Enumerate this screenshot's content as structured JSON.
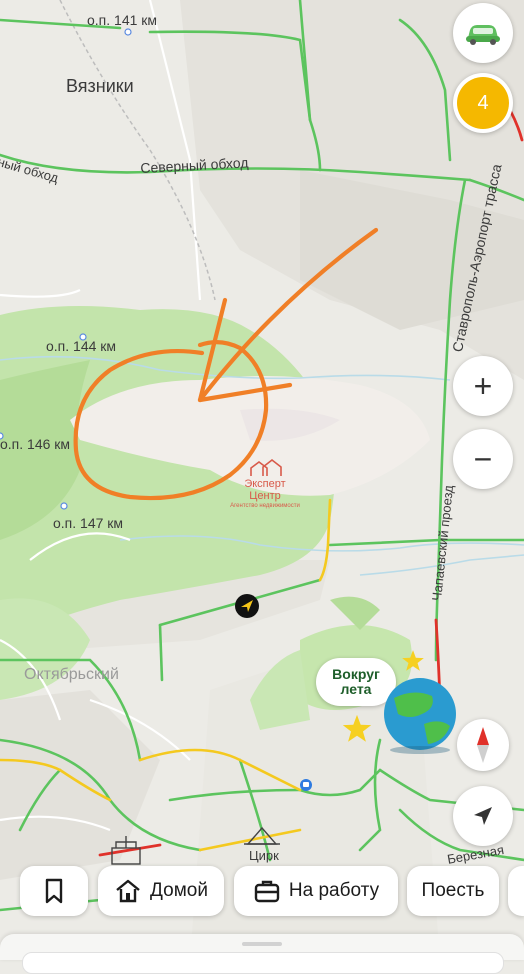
{
  "map": {
    "place_labels": {
      "vyazniki": "Вязники",
      "oktyabrsky": "Октябрьский",
      "circus": "Цирк"
    },
    "road_labels": {
      "northern_bypass_left": "ный обход",
      "northern_bypass": "Северный обход",
      "airport_road": "Ставрополь-Аэропорт трасса",
      "chapaevsky": "Чапаевский проезд",
      "beryozovaya": "Березная"
    },
    "stop_labels": {
      "op141": "о.п. 141 км",
      "op144": "о.п. 144 км",
      "op146": "о.п. 146 км",
      "op147": "о.п. 147 км"
    },
    "watermark": {
      "name": "Эксперт Центр",
      "tagline": "Агентство недвижимости"
    },
    "promo_text": "Вокруг лета",
    "annotation": "hand-drawn orange circle with arrow"
  },
  "controls": {
    "car_mode_icon": "car-icon",
    "notification_count": "4",
    "zoom_in_symbol": "+",
    "zoom_out_symbol": "−",
    "compass_icon": "compass-icon",
    "locate_icon": "navigation-arrow-icon"
  },
  "quick_actions": {
    "bookmark_icon": "bookmark-icon",
    "home_label": "Домой",
    "work_label": "На работу",
    "eat_label": "Поесть"
  },
  "colors": {
    "traffic_green": "#47c24f",
    "traffic_yellow": "#f2c81d",
    "traffic_red": "#e0312a",
    "forest": "#bfe3a6",
    "annotation": "#f07f27",
    "notification": "#f5b800"
  }
}
